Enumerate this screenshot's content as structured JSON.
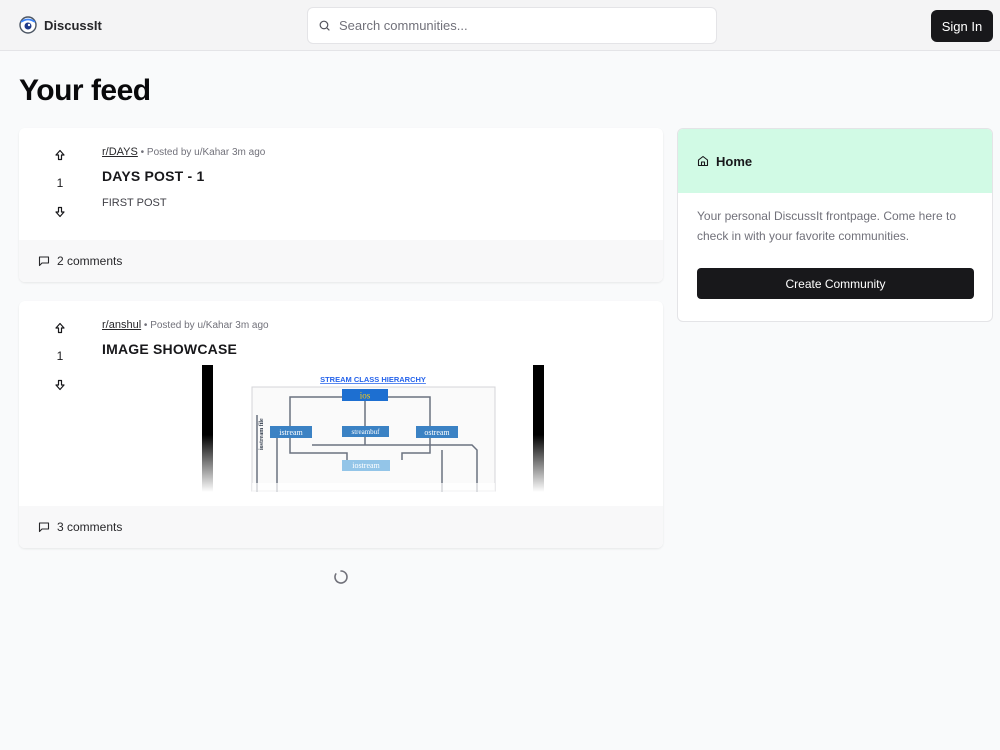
{
  "navbar": {
    "brand": "DiscussIt",
    "search_placeholder": "Search communities...",
    "signin_label": "Sign In"
  },
  "feed": {
    "title": "Your feed",
    "posts": [
      {
        "subreddit": "r/DAYS",
        "posted_by": "Posted by u/Kahar 3m ago",
        "title": "DAYS POST - 1",
        "votes": "1",
        "content": "FIRST POST",
        "comments": "2 comments"
      },
      {
        "subreddit": "r/anshul",
        "posted_by": "Posted by u/Kahar 3m ago",
        "title": "IMAGE SHOWCASE",
        "votes": "1",
        "comments": "3 comments",
        "image": {
          "heading": "STREAM CLASS HIERARCHY",
          "nodes": [
            "ios",
            "istream",
            "streambuf",
            "ostream",
            "iostream"
          ],
          "side_label": "iostream file"
        }
      }
    ]
  },
  "sidebar": {
    "title": "Home",
    "description": "Your personal DiscussIt frontpage. Come here to check in with your favorite communities.",
    "create_label": "Create Community",
    "accent": "#d1fae5"
  }
}
